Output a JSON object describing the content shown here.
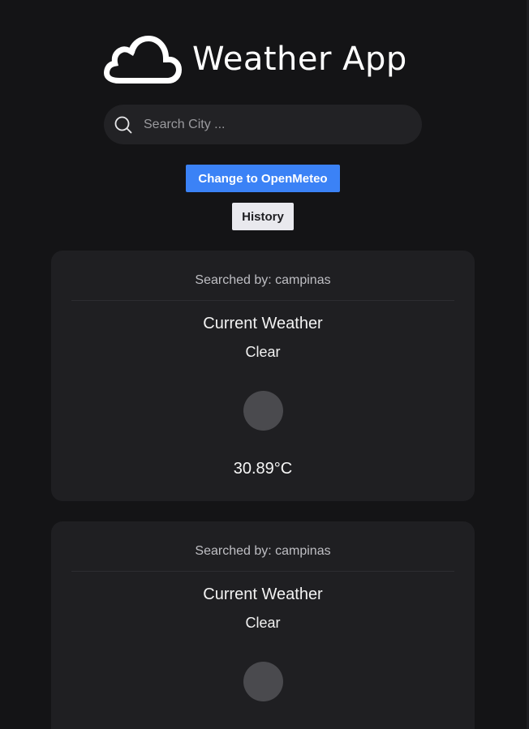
{
  "app": {
    "title": "Weather App"
  },
  "search": {
    "placeholder": "Search City ..."
  },
  "buttons": {
    "provider_label": "Change to OpenMeteo",
    "history_label": "History"
  },
  "colors": {
    "background": "#141416",
    "card": "#1f1f22",
    "accent": "#3b82f6",
    "history_button": "#e9e9ee"
  },
  "cards": [
    {
      "searched_by": "Searched by: campinas",
      "heading": "Current Weather",
      "condition": "Clear",
      "icon": "weather-condition-icon",
      "temperature": "30.89°C"
    },
    {
      "searched_by": "Searched by: campinas",
      "heading": "Current Weather",
      "condition": "Clear",
      "icon": "weather-condition-icon"
    }
  ]
}
